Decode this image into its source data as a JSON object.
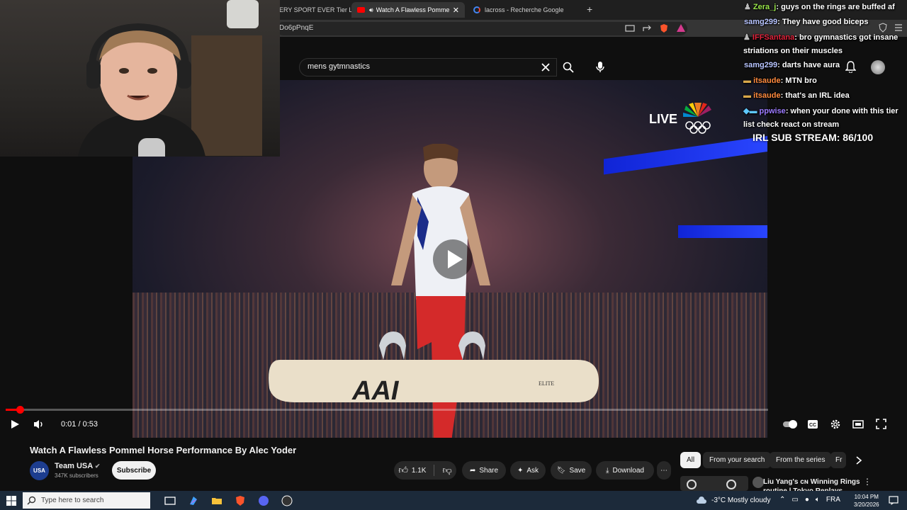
{
  "browser": {
    "tabs": [
      {
        "label": "ERY SPORT EVER Tier List"
      },
      {
        "label": "Watch A Flawless Pommel Ho",
        "active": true
      },
      {
        "label": "lacross - Recherche Google"
      }
    ],
    "new_tab": "+",
    "url_fragment": "Do6pPnqE"
  },
  "youtube": {
    "search_value": "mens gytmnastics",
    "live_label": "LIVE",
    "time": "0:01 / 0:53",
    "progress": 0.019,
    "video_title": "Watch A Flawless Pommel Horse Performance By Alec Yoder",
    "board_text": "AAI",
    "elite_text": "ELITE",
    "channel": {
      "name": "Team USA",
      "subscribers": "347K subscribers",
      "avatar_text": "USA"
    },
    "subscribe_label": "Subscribe",
    "actions": {
      "like_count": "1.1K",
      "share": "Share",
      "ask": "Ask",
      "save": "Save",
      "download": "Download"
    },
    "chips": [
      {
        "label": "All",
        "selected": true
      },
      {
        "label": "From your search"
      },
      {
        "label": "From the series"
      },
      {
        "label": "Fr"
      }
    ],
    "recommended": {
      "title_line1": "Liu Yang's ᴄɴ Winning Rings",
      "title_line2": "routine | Tokyo Replays"
    }
  },
  "stream_overlay": {
    "chat": [
      {
        "user": "Zera_j",
        "text": ": guys on the rings are buffed af",
        "color": "#9ae84a"
      },
      {
        "user": "samg299",
        "text": ": They have good biceps",
        "color": "#b7c4ff"
      },
      {
        "user": "IFFSantana",
        "text": ": bro gymnastics got insane striations on their muscles",
        "color": "#e0223a"
      },
      {
        "user": "samg299",
        "text": ": darts have aura",
        "color": "#b7c4ff"
      },
      {
        "user": "itsaude",
        "text": ": MTN bro",
        "color": "#ff8a3d"
      },
      {
        "user": "itsaude",
        "text": ": that's an IRL idea",
        "color": "#ff8a3d"
      },
      {
        "user": "ppwise",
        "text": ": when your done with this tier list check react on stream",
        "color": "#9d7bff"
      }
    ],
    "sub_goal": "IRL SUB STREAM: 86/100"
  },
  "taskbar": {
    "search_placeholder": "Type here to search",
    "weather": "-3°C  Mostly cloudy",
    "language": "FRA",
    "time": "10:04 PM",
    "date": "3/20/2026"
  }
}
